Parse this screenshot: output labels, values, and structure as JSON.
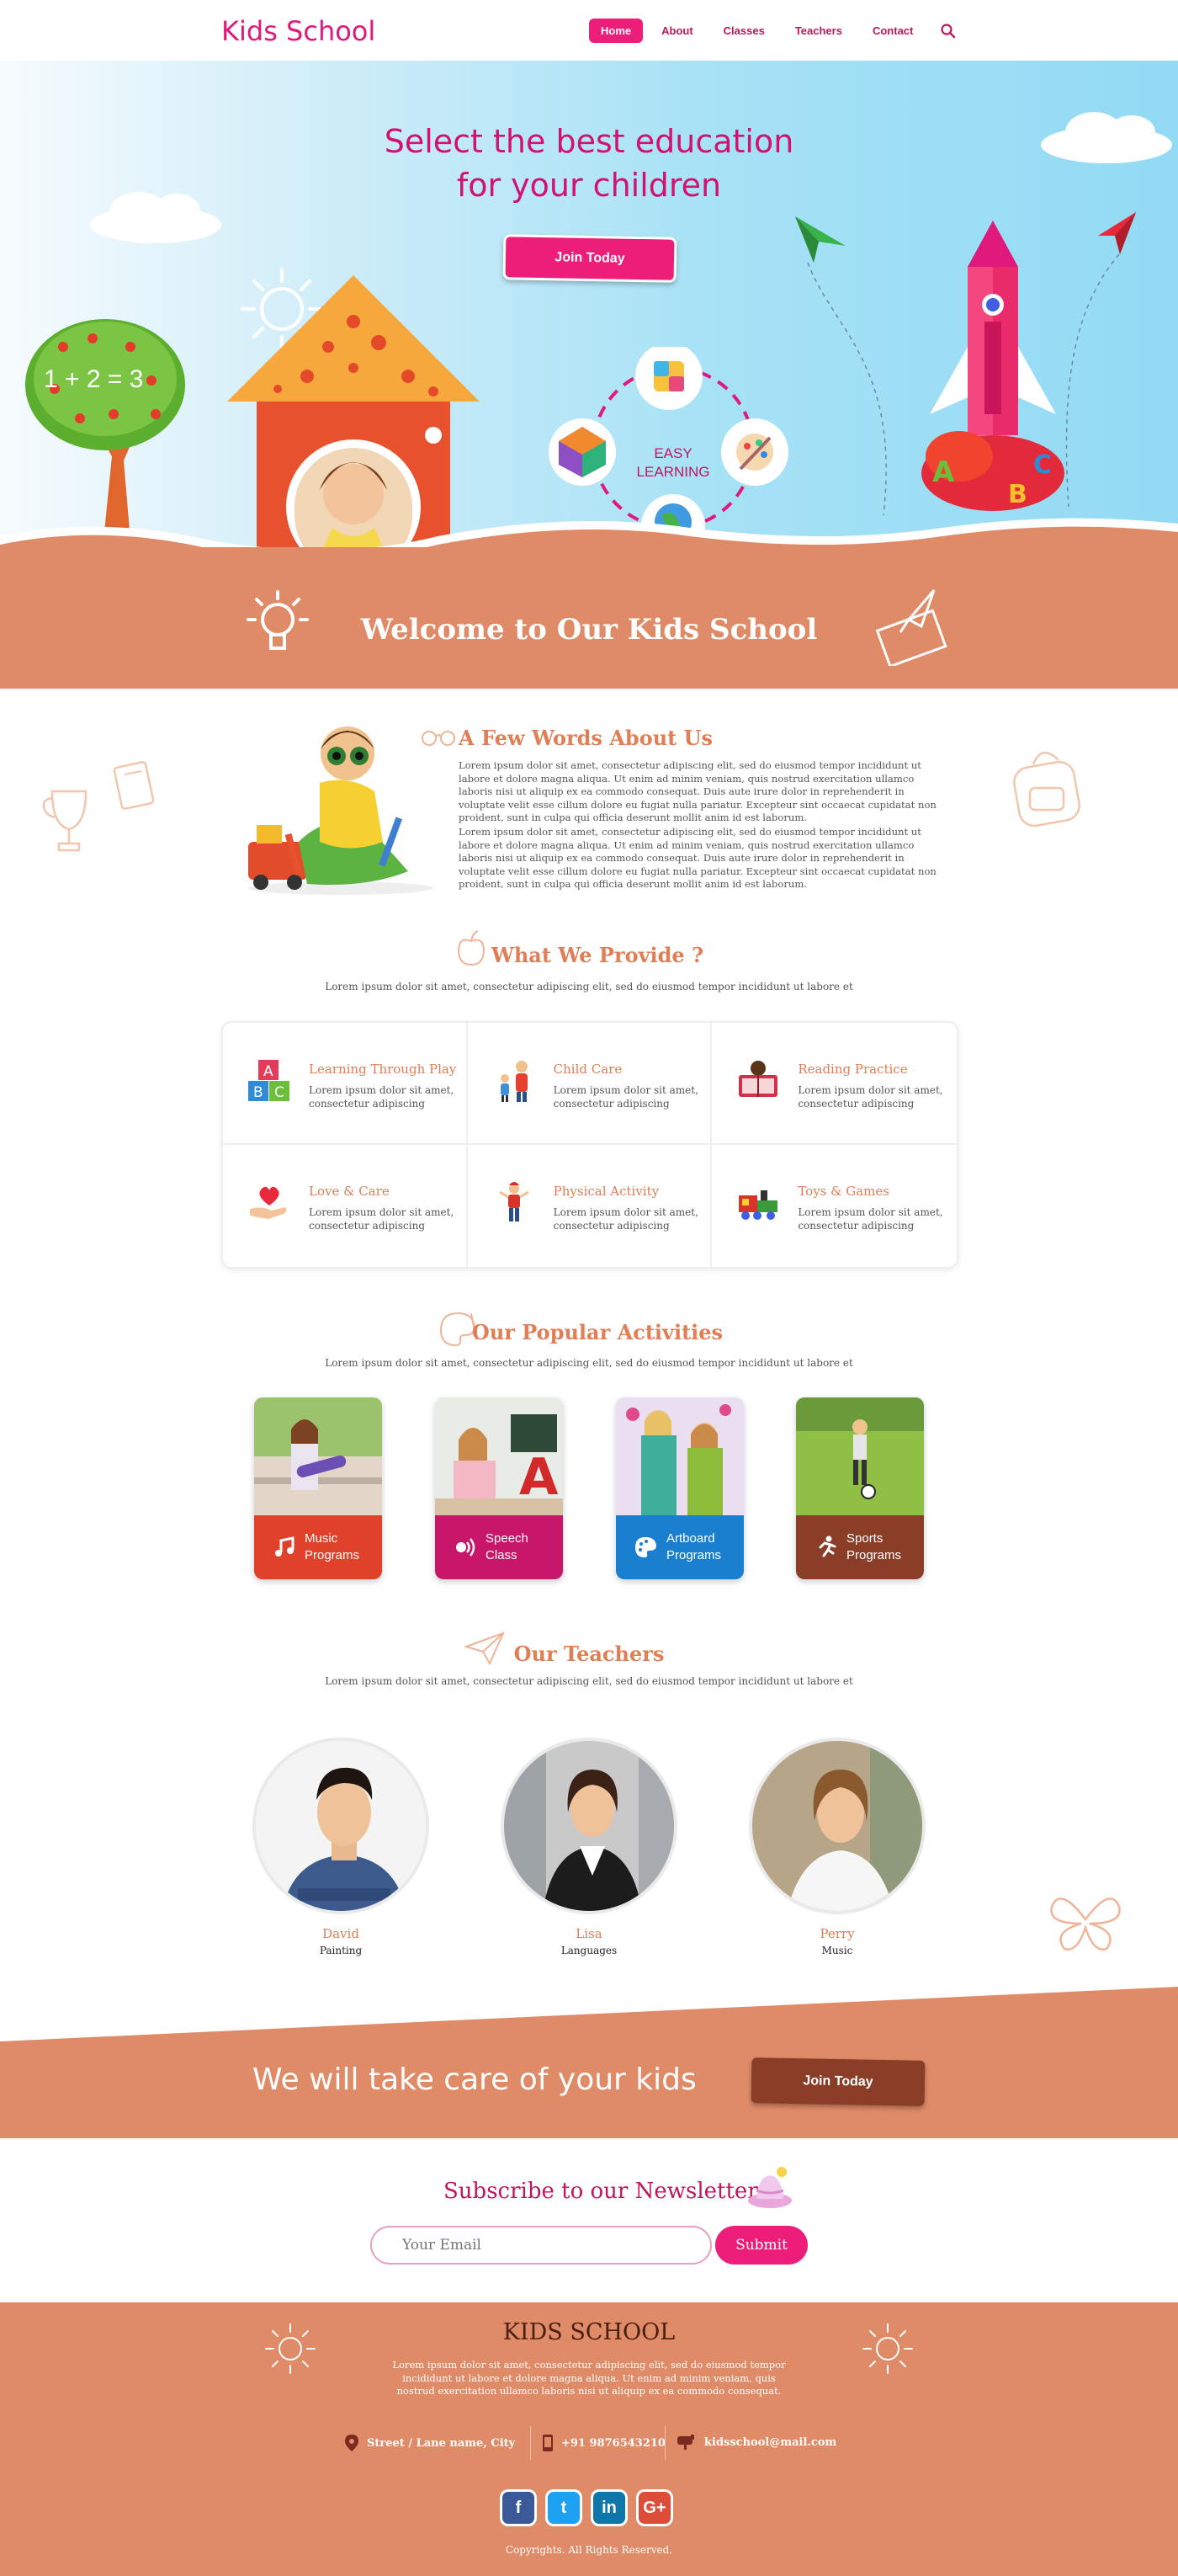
{
  "header": {
    "logo": "Kids School",
    "nav": [
      "Home",
      "About",
      "Classes",
      "Teachers",
      "Contact"
    ],
    "active_nav": "Home",
    "search_icon": "search-icon"
  },
  "hero": {
    "title_line1": "Select the best education",
    "title_line2": "for your children",
    "join_label": "Join Today",
    "tree_math": "1 + 2 = 3",
    "easy_line1": "EASY",
    "easy_line2": "LEARNING",
    "welcome": "Welcome to Our Kids School"
  },
  "about": {
    "title": "A Few Words About Us",
    "para1": "Lorem ipsum dolor sit amet, consectetur adipiscing elit, sed do eiusmod tempor incididunt ut labore et dolore magna aliqua. Ut enim ad minim veniam, quis nostrud exercitation ullamco laboris nisi ut aliquip ex ea commodo consequat. Duis aute irure dolor in reprehenderit in voluptate velit esse cillum dolore eu fugiat nulla pariatur. Excepteur sint occaecat cupidatat non proident, sunt in culpa qui officia deserunt mollit anim id est laborum.",
    "para2": "Lorem ipsum dolor sit amet, consectetur adipiscing elit, sed do eiusmod tempor incididunt ut labore et dolore magna aliqua. Ut enim ad minim veniam, quis nostrud exercitation ullamco laboris nisi ut aliquip ex ea commodo consequat. Duis aute irure dolor in reprehenderit in voluptate velit esse cillum dolore eu fugiat nulla pariatur. Excepteur sint occaecat cupidatat non proident, sunt in culpa qui officia deserunt mollit anim id est laborum."
  },
  "provide": {
    "title": "What We Provide ?",
    "subtitle": "Lorem ipsum dolor sit amet, consectetur adipiscing elit, sed do eiusmod tempor incididunt ut labore et",
    "items": [
      {
        "title": "Learning Through Play",
        "desc": "Lorem ipsum dolor sit amet, consectetur adipiscing",
        "icon": "abc-blocks-icon"
      },
      {
        "title": "Child Care",
        "desc": "Lorem ipsum dolor sit amet, consectetur adipiscing",
        "icon": "parent-child-icon"
      },
      {
        "title": "Reading Practice",
        "desc": "Lorem ipsum dolor sit amet, consectetur adipiscing",
        "icon": "reading-icon"
      },
      {
        "title": "Love & Care",
        "desc": "Lorem ipsum dolor sit amet, consectetur adipiscing",
        "icon": "heart-hand-icon"
      },
      {
        "title": "Physical Activity",
        "desc": "Lorem ipsum dolor sit amet, consectetur adipiscing",
        "icon": "child-exercise-icon"
      },
      {
        "title": "Toys & Games",
        "desc": "Lorem ipsum dolor sit amet, consectetur adipiscing",
        "icon": "toy-train-icon"
      }
    ]
  },
  "activities": {
    "title": "Our Popular Activities",
    "subtitle": "Lorem ipsum dolor sit amet, consectetur adipiscing elit, sed do eiusmod tempor incididunt ut labore et",
    "items": [
      {
        "line1": "Music",
        "line2": "Programs",
        "color": "#e0412a",
        "icon": "music-note-icon"
      },
      {
        "line1": "Speech",
        "line2": "Class",
        "color": "#c8176a",
        "icon": "speech-icon"
      },
      {
        "line1": "Artboard",
        "line2": "Programs",
        "color": "#1b7fcf",
        "icon": "palette-icon"
      },
      {
        "line1": "Sports",
        "line2": "Programs",
        "color": "#8a3e27",
        "icon": "running-icon"
      }
    ]
  },
  "teachers": {
    "title": "Our Teachers",
    "subtitle": "Lorem ipsum dolor sit amet, consectetur adipiscing elit, sed do eiusmod tempor incididunt ut labore et",
    "items": [
      {
        "name": "David",
        "subject": "Painting"
      },
      {
        "name": "Lisa",
        "subject": "Languages"
      },
      {
        "name": "Perry",
        "subject": "Music"
      }
    ]
  },
  "care": {
    "text": "We will take care of your kids",
    "join_label": "Join Today"
  },
  "newsletter": {
    "title": "Subscribe to our Newsletter",
    "placeholder": "Your Email",
    "submit_label": "Submit"
  },
  "footer": {
    "title": "KIDS SCHOOL",
    "desc": "Lorem ipsum dolor sit amet, consectetur  adipiscing elit, sed do eiusmod tempor incididunt ut labore et dolore magna aliqua. Ut enim ad minim veniam, quis nostrud exercitation ullamco laboris nisi ut aliquip ex ea commodo consequat.",
    "address": "Street / Lane name,  City",
    "phone": "+91 9876543210",
    "email": "kidsschool@mail.com",
    "social": [
      {
        "glyph": "f",
        "icon": "facebook-icon",
        "color": "#3b5998"
      },
      {
        "glyph": "t",
        "icon": "twitter-icon",
        "color": "#1da1f2"
      },
      {
        "glyph": "in",
        "icon": "linkedin-icon",
        "color": "#0e76a8"
      },
      {
        "glyph": "G+",
        "icon": "google-plus-icon",
        "color": "#dd4b39"
      }
    ],
    "copyright": "Copyrights. All Rights Reserved."
  },
  "colors": {
    "brand_pink": "#ed1e79",
    "accent_orange": "#df8b68",
    "dark_brown": "#8a3e27"
  }
}
